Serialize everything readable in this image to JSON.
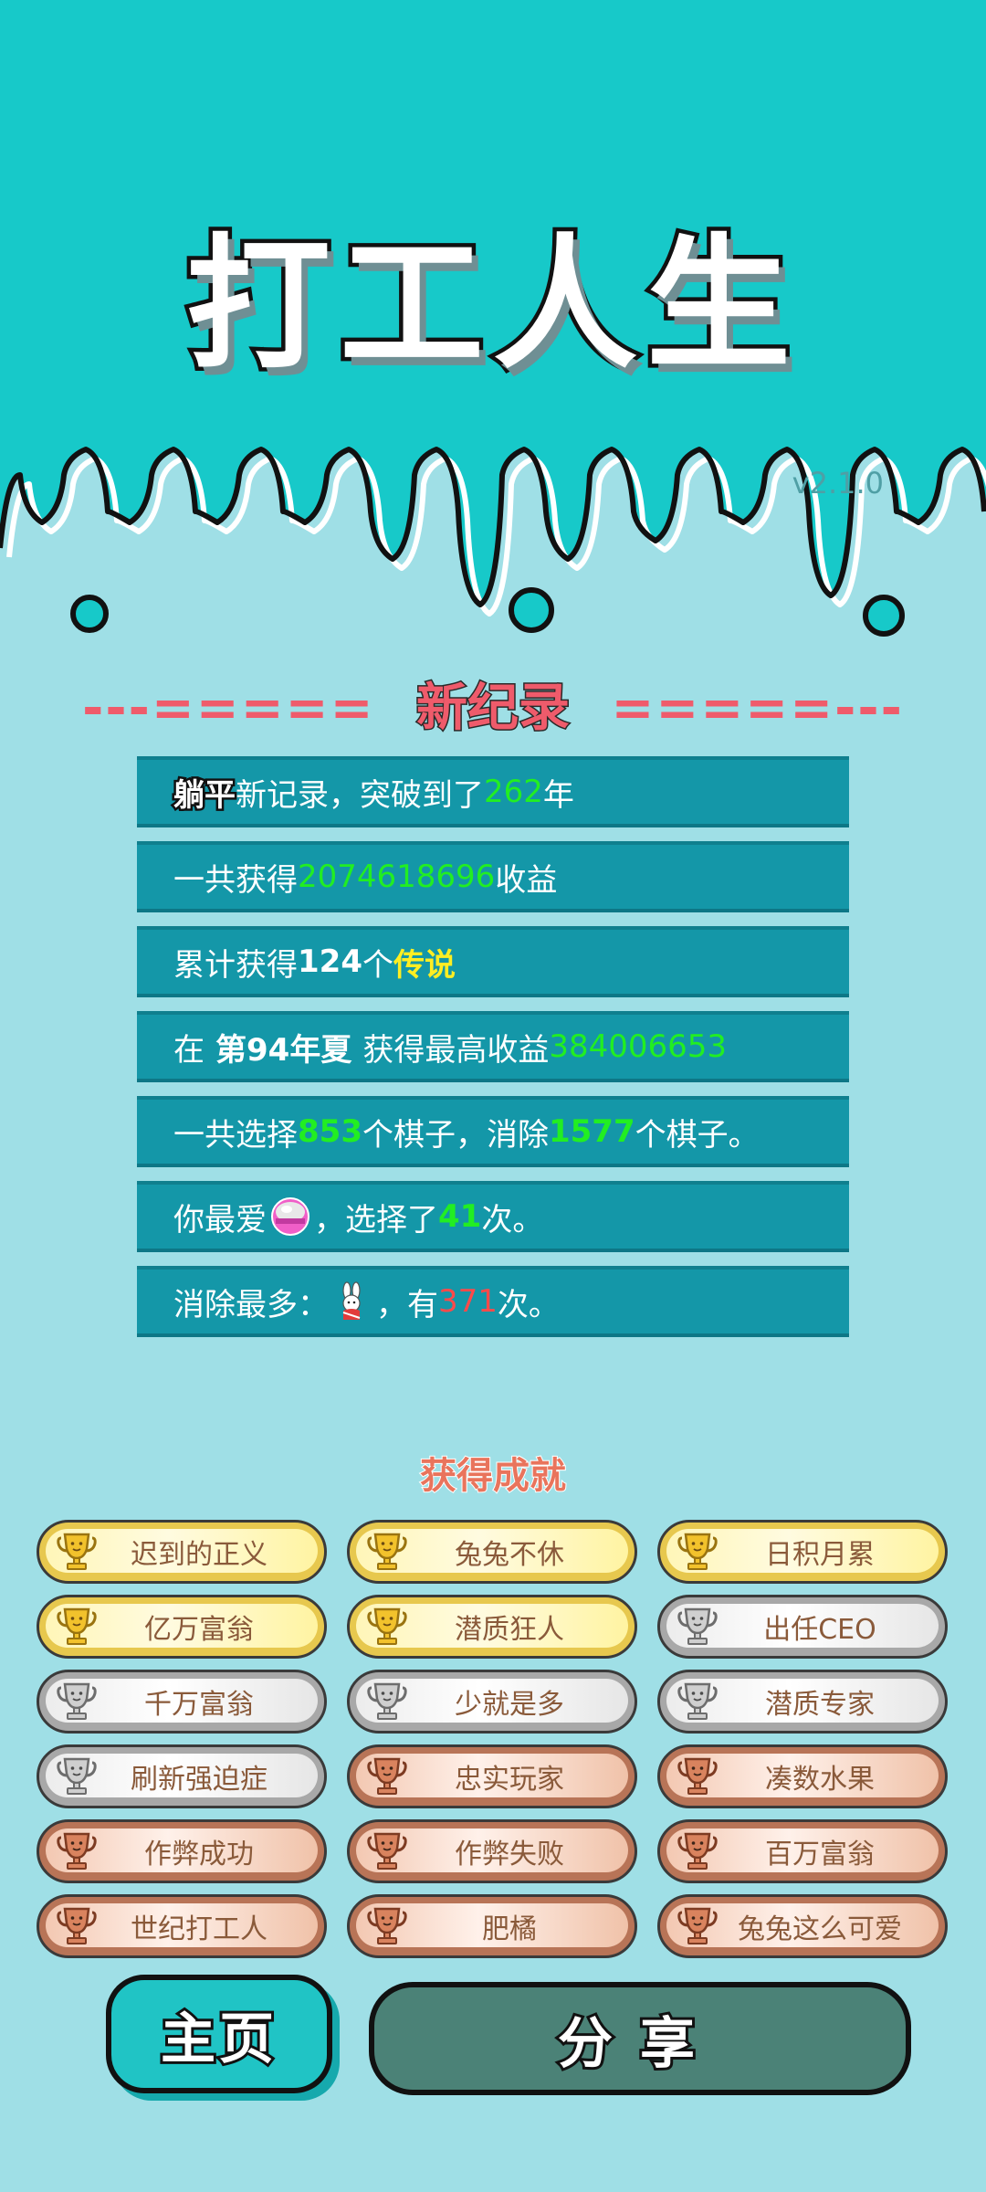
{
  "header": {
    "title": "打工人生",
    "version": "v2.1.0"
  },
  "record": {
    "heading_left": "---=====",
    "heading": "新纪录",
    "heading_right": "=====---",
    "rows": [
      {
        "tag": "躺平",
        "text1": "新记录，突破到了",
        "value": "262",
        "text2": "年"
      },
      {
        "text1": "一共获得",
        "value": "2074618696",
        "text2": "收益"
      },
      {
        "text1": "累计获得",
        "value": "124",
        "text2": "个",
        "tag": "传说"
      },
      {
        "text1": "在",
        "season": "第94年夏",
        "text2": "获得最高收益",
        "value": "384006653"
      },
      {
        "text1": "一共选择",
        "value": "853",
        "text2": "个棋子，消除",
        "value2": "1577",
        "text3": "个棋子。"
      },
      {
        "text1": "你最爱",
        "icon": "rice-bowl-icon",
        "text2": "，选择了",
        "value": "41",
        "text3": "次。"
      },
      {
        "text1": "消除最多：",
        "icon": "bunny-icon",
        "text2": "，有",
        "value": "371",
        "text3": "次。"
      }
    ]
  },
  "achievements": {
    "title": "获得成就",
    "items": [
      {
        "label": "迟到的正义",
        "tier": "gold"
      },
      {
        "label": "兔兔不休",
        "tier": "gold"
      },
      {
        "label": "日积月累",
        "tier": "gold"
      },
      {
        "label": "亿万富翁",
        "tier": "gold"
      },
      {
        "label": "潜质狂人",
        "tier": "gold"
      },
      {
        "label": "出任CEO",
        "tier": "silver"
      },
      {
        "label": "千万富翁",
        "tier": "silver"
      },
      {
        "label": "少就是多",
        "tier": "silver"
      },
      {
        "label": "潜质专家",
        "tier": "silver"
      },
      {
        "label": "刷新强迫症",
        "tier": "silver"
      },
      {
        "label": "忠实玩家",
        "tier": "bronze"
      },
      {
        "label": "凑数水果",
        "tier": "bronze"
      },
      {
        "label": "作弊成功",
        "tier": "bronze"
      },
      {
        "label": "作弊失败",
        "tier": "bronze"
      },
      {
        "label": "百万富翁",
        "tier": "bronze"
      },
      {
        "label": "世纪打工人",
        "tier": "bronze"
      },
      {
        "label": "肥橘",
        "tier": "bronze"
      },
      {
        "label": "兔兔这么可爱",
        "tier": "bronze"
      }
    ]
  },
  "buttons": {
    "home": "主页",
    "share": "分享"
  },
  "colors": {
    "top_bg": "#17c9c9",
    "body_bg": "#9fdfe6",
    "row_bg": "#1497a8",
    "value_green": "#22ee22",
    "legend_yellow": "#ffee22",
    "value_red": "#ff4a4a",
    "heading_pink": "#ef5b6b"
  }
}
